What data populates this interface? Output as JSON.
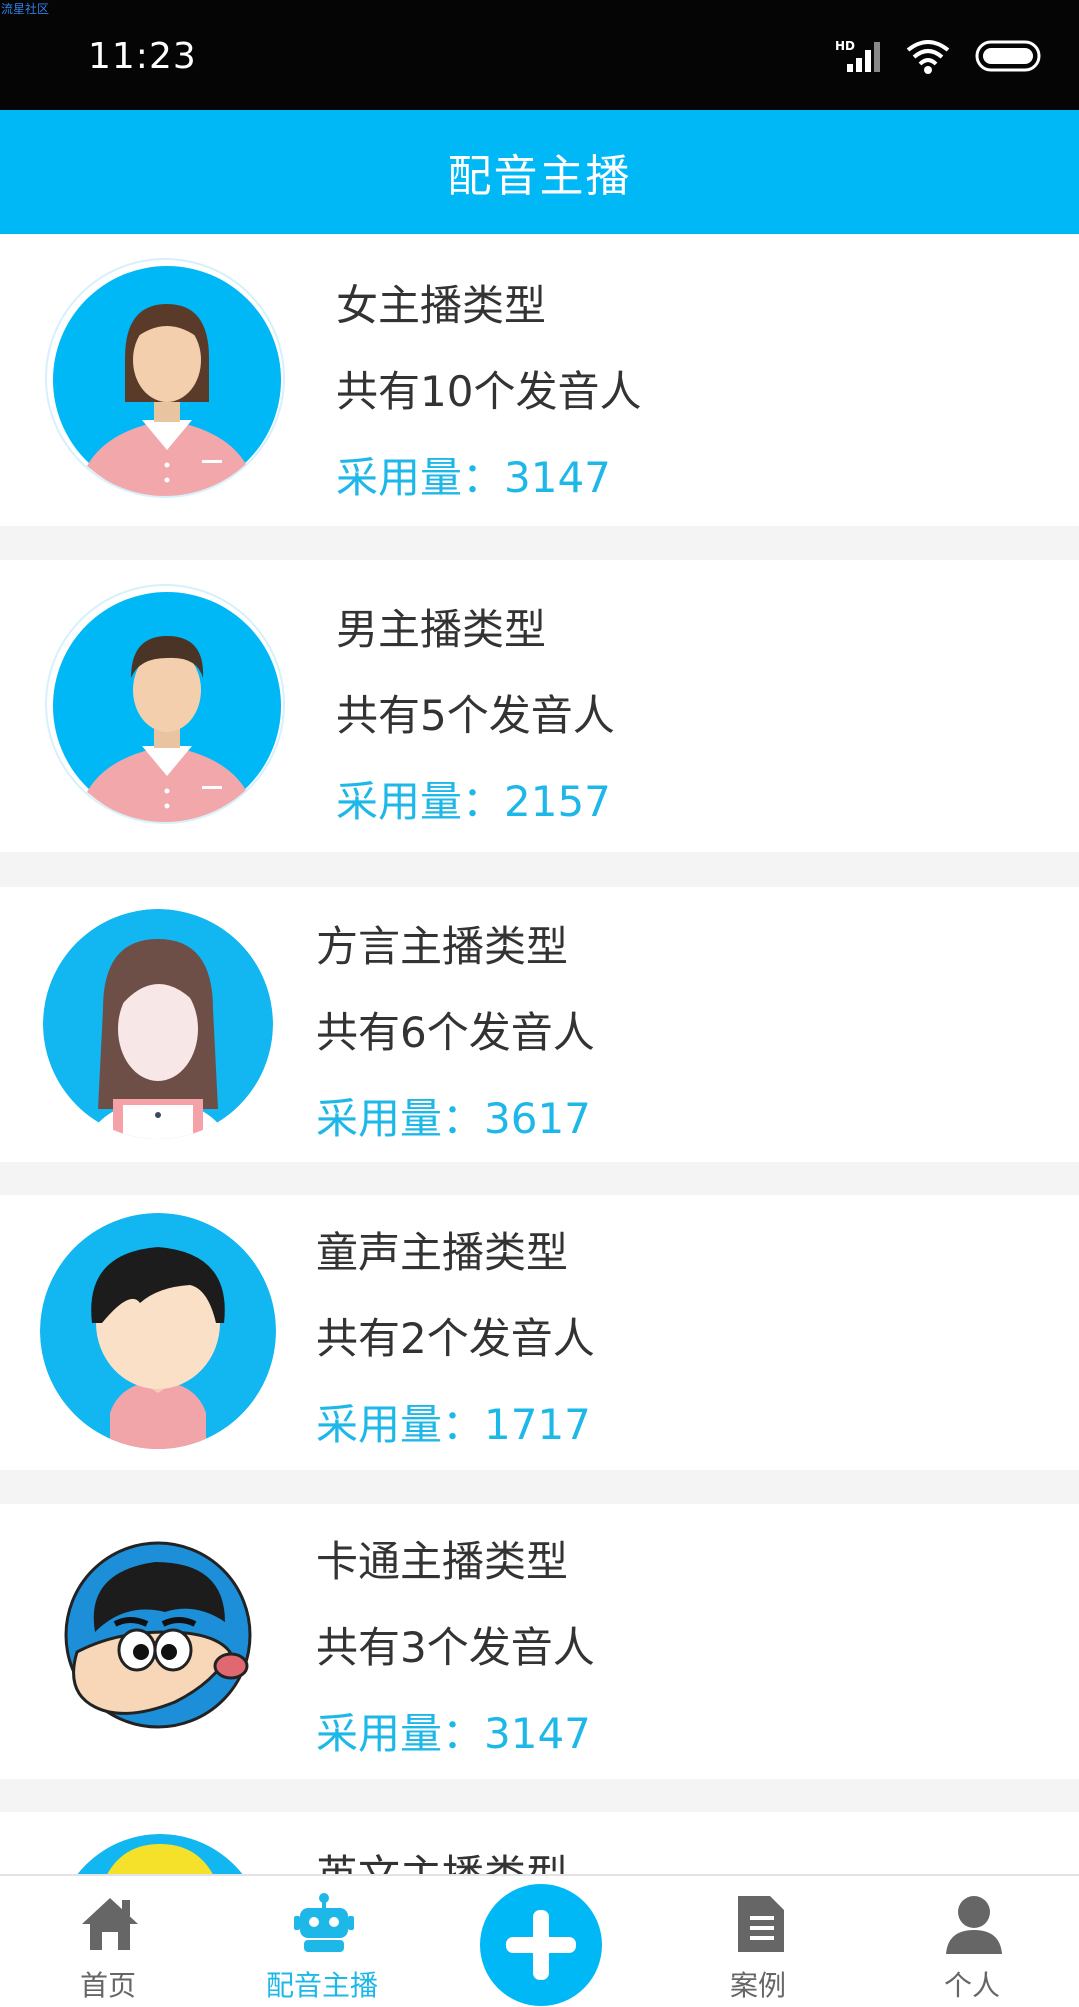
{
  "status_bar": {
    "watermark": "流星社区",
    "time": "11:23",
    "icons": [
      "hd-signal-icon",
      "wifi-icon",
      "battery-icon"
    ]
  },
  "header": {
    "title": "配音主播"
  },
  "anchor_types": [
    {
      "name": "女主播类型",
      "count_text": "共有10个发音人",
      "usage_text": "采用量：3147",
      "avatar": "female-avatar"
    },
    {
      "name": "男主播类型",
      "count_text": "共有5个发音人",
      "usage_text": "采用量：2157",
      "avatar": "male-avatar"
    },
    {
      "name": "方言主播类型",
      "count_text": "共有6个发音人",
      "usage_text": "采用量：3617",
      "avatar": "long-hair-avatar"
    },
    {
      "name": "童声主播类型",
      "count_text": "共有2个发音人",
      "usage_text": "采用量：1717",
      "avatar": "child-avatar"
    },
    {
      "name": "卡通主播类型",
      "count_text": "共有3个发音人",
      "usage_text": "采用量：3147",
      "avatar": "cartoon-avatar"
    },
    {
      "name": "英文主播类型",
      "avatar": "blonde-avatar"
    }
  ],
  "bottom_nav": {
    "items": [
      {
        "label": "首页",
        "icon": "home-icon"
      },
      {
        "label": "配音主播",
        "icon": "robot-icon",
        "active": true
      },
      {
        "label": "",
        "icon": "plus-icon"
      },
      {
        "label": "案例",
        "icon": "document-icon"
      },
      {
        "label": "个人",
        "icon": "person-icon"
      }
    ]
  },
  "colors": {
    "accent": "#00b8f5",
    "usage_text": "#1db7e8",
    "status_bar": "#050505",
    "page_bg": "#f4f4f4",
    "avatar_shirt": "#f2a7ab"
  }
}
